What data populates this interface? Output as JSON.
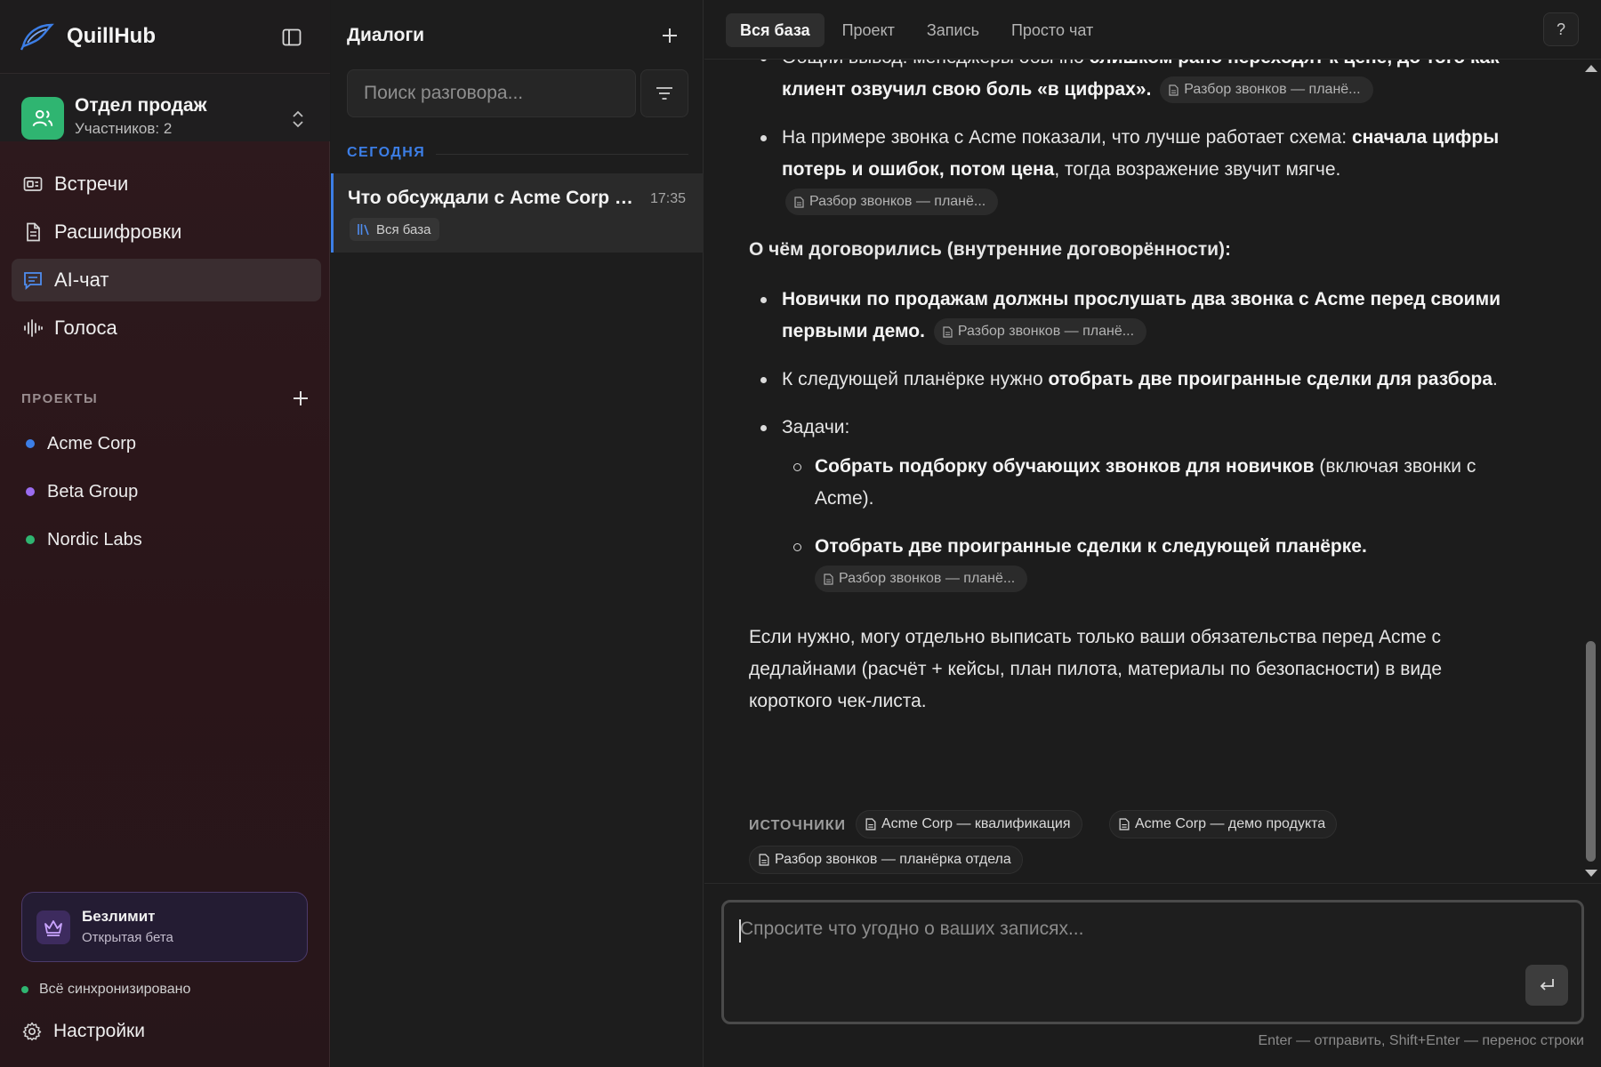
{
  "app": {
    "name": "QuillHub"
  },
  "team": {
    "name": "Отдел продаж",
    "members": "Участников: 2",
    "accent": "#2fb571"
  },
  "nav": {
    "items": [
      {
        "label": "Встречи",
        "icon": "meetings-icon"
      },
      {
        "label": "Расшифровки",
        "icon": "document-icon"
      },
      {
        "label": "AI-чат",
        "icon": "chat-icon",
        "active": true
      },
      {
        "label": "Голоса",
        "icon": "waveform-icon"
      }
    ]
  },
  "projects": {
    "title": "ПРОЕКТЫ",
    "items": [
      {
        "label": "Acme Corp",
        "color": "#3c7ee6"
      },
      {
        "label": "Beta Group",
        "color": "#9b6cf0"
      },
      {
        "label": "Nordic Labs",
        "color": "#2fb571"
      }
    ]
  },
  "plan": {
    "title": "Безлимит",
    "subtitle": "Открытая бета"
  },
  "sync": {
    "status": "Всё синхронизировано"
  },
  "settings": {
    "label": "Настройки"
  },
  "dialogs": {
    "title": "Диалоги",
    "search_placeholder": "Поиск разговора...",
    "section": "СЕГОДНЯ",
    "items": [
      {
        "title": "Что обсуждали с Acme Corp и...",
        "time": "17:35",
        "tag": "Вся база"
      }
    ]
  },
  "tabs": [
    {
      "label": "Вся база",
      "active": true
    },
    {
      "label": "Проект"
    },
    {
      "label": "Запись"
    },
    {
      "label": "Просто чат"
    }
  ],
  "help": "?",
  "answer": {
    "p1_pre": "Общий вывод: менеджеры обычно ",
    "p1_bold": "слишком рано переходят к цене",
    "p1_post": ", до того как клиент озвучил свою боль «в цифрах».",
    "p2_pre": "На примере звонка с Acme показали, что лучше работает схема: ",
    "p2_bold": "сначала цифры потерь и ошибок, потом цена",
    "p2_post": ", тогда возражение звучит мягче.",
    "heading": "О чём договорились (внутренние договорённости):",
    "p3_bold": "Новички по продажам должны прослушать два звонка с Acme перед своими первыми демо.",
    "p4_pre": "К следующей планёрке нужно ",
    "p4_bold": "отобрать две проигранные сделки для разбора",
    "p4_post": ".",
    "p5": "Задачи:",
    "s1_bold": "Собрать подборку обучающих звонков для новичков",
    "s1_post": " (включая звонки с Acme).",
    "s2_bold": "Отобрать две проигранные сделки к следующей планёрке.",
    "final": "Если нужно, могу отдельно выписать только ваши обязательства перед Acme с дедлайнами (расчёт + кейсы, план пилота, материалы по безопасности) в виде короткого чек-листа.",
    "cite": "Разбор звонков — планё..."
  },
  "sources": {
    "label": "ИСТОЧНИКИ",
    "items": [
      "Acme Corp — квалификация",
      "Acme Corp — демо продукта",
      "Разбор звонков — планёрка отдела"
    ]
  },
  "input": {
    "placeholder": "Спросите что угодно о ваших записях...",
    "hint": "Enter — отправить, Shift+Enter — перенос строки"
  }
}
